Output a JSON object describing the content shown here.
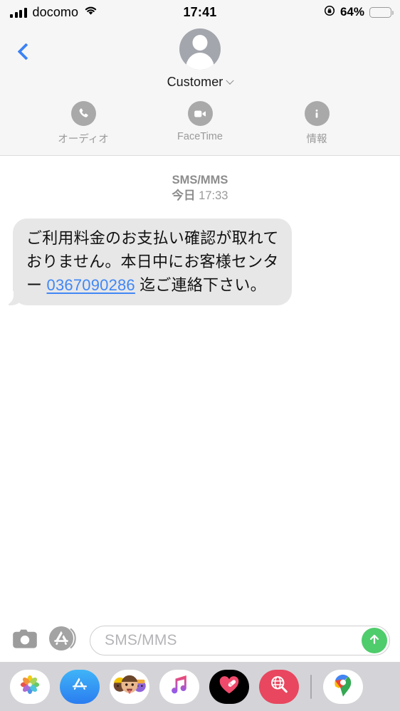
{
  "statusbar": {
    "carrier": "docomo",
    "signal_icon": "cellular-bars-icon",
    "wifi_icon": "wifi-icon",
    "time": "17:41",
    "rotation_lock_icon": "rotation-lock-icon",
    "battery_percent": "64%",
    "battery_level": 64,
    "battery_color": "#fcd34d"
  },
  "navbar": {
    "back_icon": "back-chevron-icon",
    "avatar_icon": "person-avatar-icon",
    "contact_name": "Customer",
    "disclosure_icon": "chevron-down-icon",
    "actions": [
      {
        "label": "オーディオ",
        "icon": "phone-icon"
      },
      {
        "label": "FaceTime",
        "icon": "video-camera-icon"
      },
      {
        "label": "情報",
        "icon": "info-icon"
      }
    ]
  },
  "thread": {
    "service_label": "SMS/MMS",
    "day_label": "今日",
    "time_label": "17:33",
    "message": {
      "sender": "incoming",
      "line1": "ご利用料金のお支払い確認が取れ",
      "line2": "ておりません。本日中にお客様セ",
      "line3_prefix": "ンター ",
      "phone_link": "0367090286",
      "line3_suffix": " 迄ご連絡下",
      "line4": "さい。",
      "full_text": "ご利用料金のお支払い確認が取れておりません。本日中にお客様センター 0367090286 迄ご連絡下さい。",
      "bubble_color": "#e7e7e8",
      "link_color": "#4187f5"
    }
  },
  "inputbar": {
    "camera_icon": "camera-icon",
    "appstore_icon": "app-store-icon",
    "placeholder": "SMS/MMS",
    "value": "",
    "send_icon": "send-arrow-up-icon",
    "send_color": "#4fcc6c"
  },
  "dock": {
    "apps": [
      {
        "name": "photos-app",
        "icon": "photos-icon"
      },
      {
        "name": "app-store-app",
        "icon": "app-store-icon"
      },
      {
        "name": "memoji-app",
        "icon": "memoji-icon"
      },
      {
        "name": "music-app",
        "icon": "music-note-icon"
      },
      {
        "name": "digital-touch-app",
        "icon": "heart-bandage-icon"
      },
      {
        "name": "image-search-app",
        "icon": "globe-magnifier-icon"
      },
      {
        "name": "google-maps-app",
        "icon": "map-pin-icon"
      }
    ]
  }
}
